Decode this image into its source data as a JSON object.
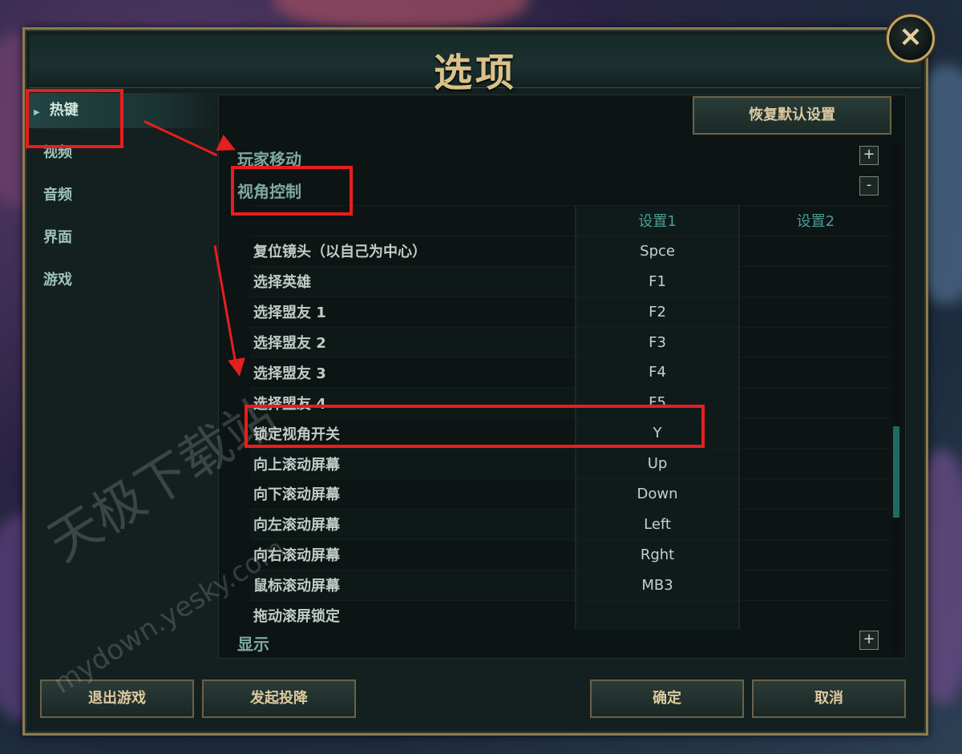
{
  "dialog": {
    "title": "选项",
    "close_icon": "×"
  },
  "sidebar": {
    "items": [
      {
        "label": "热键",
        "active": true
      },
      {
        "label": "视频"
      },
      {
        "label": "音频"
      },
      {
        "label": "界面"
      },
      {
        "label": "游戏"
      }
    ]
  },
  "main": {
    "reset_label": "恢复默认设置",
    "sections": [
      {
        "title": "玩家移动",
        "toggle": "+"
      },
      {
        "title": "视角控制",
        "toggle": "-"
      },
      {
        "title": "显示",
        "toggle": "+"
      }
    ],
    "columns": {
      "setting1": "设置1",
      "setting2": "设置2"
    },
    "rows": [
      {
        "name": "复位镜头（以自己为中心）",
        "key1": "Spce",
        "key2": ""
      },
      {
        "name": "选择英雄",
        "key1": "F1",
        "key2": ""
      },
      {
        "name": "选择盟友 1",
        "key1": "F2",
        "key2": ""
      },
      {
        "name": "选择盟友 2",
        "key1": "F3",
        "key2": ""
      },
      {
        "name": "选择盟友 3",
        "key1": "F4",
        "key2": ""
      },
      {
        "name": "选择盟友 4",
        "key1": "F5",
        "key2": ""
      },
      {
        "name": "锁定视角开关",
        "key1": "Y",
        "key2": ""
      },
      {
        "name": "向上滚动屏幕",
        "key1": "Up",
        "key2": ""
      },
      {
        "name": "向下滚动屏幕",
        "key1": "Down",
        "key2": ""
      },
      {
        "name": "向左滚动屏幕",
        "key1": "Left",
        "key2": ""
      },
      {
        "name": "向右滚动屏幕",
        "key1": "Rght",
        "key2": ""
      },
      {
        "name": "鼠标滚动屏幕",
        "key1": "MB3",
        "key2": ""
      },
      {
        "name": "拖动滚屏锁定",
        "key1": "",
        "key2": ""
      }
    ]
  },
  "footer": {
    "quit_label": "退出游戏",
    "surrender_label": "发起投降",
    "ok_label": "确定",
    "cancel_label": "取消"
  },
  "watermark": {
    "line1": "天极下载站",
    "line2": "mydown.yesky.com"
  },
  "colors": {
    "accent_gold": "#d9c289",
    "panel_bg": "#14201f",
    "annotation_red": "#ea1d1d",
    "section_teal": "#7fa9a1"
  }
}
